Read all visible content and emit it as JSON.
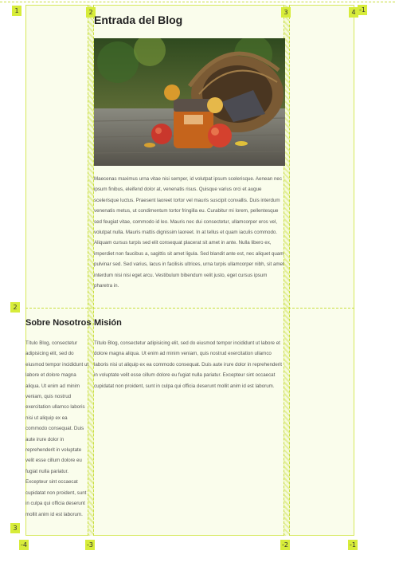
{
  "grid": {
    "col_lines": [
      "1",
      "2",
      "3",
      "4",
      "-1"
    ],
    "row_lines": [
      "2",
      "3"
    ],
    "neg_lines": [
      "-4",
      "-3",
      "-2",
      "-1"
    ]
  },
  "blog": {
    "title": "Entrada del Blog",
    "image_alt": "Basket of apples with a jar of jam",
    "body": "Maecenas maximus urna vitae nisi semper, id volutpat ipsum scelerisque. Aenean nec ipsum finibus, eleifend dolor at, venenatis risus. Quisque varius orci et augue scelerisque luctus. Praesent laoreet tortor vel mauris suscipit convallis. Duis interdum venenatis metus, ut condimentum tortor fringilla eu. Curabitur mi lorem, pellentesque sed feugiat vitae, commodo id leo. Mauris nec dui consectetur, ullamcorper eros vel, volutpat nulla. Mauris mattis dignissim laoreet. In at tellus et quam iaculis commodo. Aliquam cursus turpis sed elit consequat placerat sit amet in ante. Nulla libero ex, imperdiet non faucibus a, sagittis sit amet ligula. Sed blandit ante est, nec aliquet quam pulvinar sed. Sed varius, lacus in facilisis ultrices, urna turpis ullamcorper nibh, sit amet interdum nisi nisi eget arcu. Vestibulum bibendum velit justo, eget cursus ipsum pharetra in."
  },
  "about": {
    "title": "Sobre Nosotros",
    "body": "Título Blog, consectetur adipisicing elit, sed do eiusmod tempor incididunt ut labore et dolore magna aliqua. Ut enim ad minim veniam, quis nostrud exercitation ullamco laboris nisi ut aliquip ex ea commodo consequat. Duis aute irure dolor in reprehenderit in voluptate velit esse cillum dolore eu fugiat nulla pariatur. Excepteur sint occaecat cupidatat non proident, sunt in culpa qui officia deserunt mollit anim id est laborum."
  },
  "mission": {
    "title": "Misión",
    "body": "Título Blog, consectetur adipisicing elit, sed do eiusmod tempor incididunt ut labore et dolore magna aliqua. Ut enim ad minim veniam, quis nostrud exercitation ullamco laboris nisi ut aliquip ex ea commodo consequat. Duis aute irure dolor in reprehenderit in voluptate velit esse cillum dolore eu fugiat nulla pariatur. Excepteur sint occaecat cupidatat non proident, sunt in culpa qui officia deserunt mollit anim id est laborum."
  },
  "colors": {
    "grid_overlay": "#fafdec",
    "grid_line": "#c9de3e",
    "badge": "#d7ec3a"
  }
}
